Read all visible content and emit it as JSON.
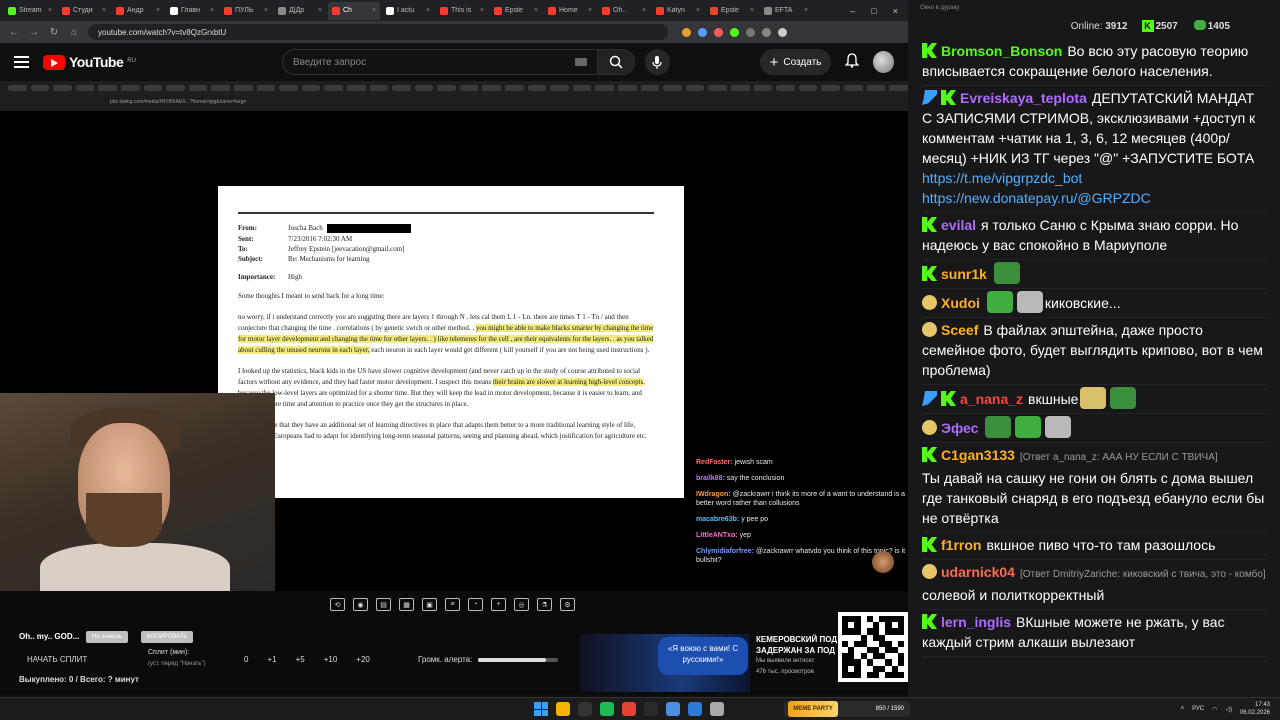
{
  "browser": {
    "tabs": [
      {
        "label": "Stream",
        "color": "#53fc18"
      },
      {
        "label": "Студи",
        "color": "#ff3b30"
      },
      {
        "label": "Андр",
        "color": "#ff3b30"
      },
      {
        "label": "Главн",
        "color": "#ffffff"
      },
      {
        "label": "ПУЛЬ",
        "color": "#ff3b30"
      },
      {
        "label": "Д|Др",
        "color": "#8a8a8a"
      },
      {
        "label": "Ch",
        "color": "#ff3b30",
        "active": true
      },
      {
        "label": "I actu",
        "color": "#ffffff"
      },
      {
        "label": "This is",
        "color": "#ff3b30"
      },
      {
        "label": "Epste",
        "color": "#ff3b30"
      },
      {
        "label": "Home",
        "color": "#ff3b30"
      },
      {
        "label": "Oh..",
        "color": "#ff3b30"
      },
      {
        "label": "Katyn",
        "color": "#ff3b30"
      },
      {
        "label": "Epste",
        "color": "#e04a2a"
      },
      {
        "label": "EFTA",
        "color": "#8a8a8a"
      }
    ],
    "url": "youtube.com/watch?v=tv8QzGrxbtU"
  },
  "youtube": {
    "logo": "YouTube",
    "region": "RU",
    "search_placeholder": "Введите запрос",
    "create_label": "Создать"
  },
  "video": {
    "inner_url": "pbs.twimg.com/media/HFH6hAEX...?format=jpg&name=large",
    "document": {
      "from_label": "From:",
      "from_value": "Joscha Bach",
      "sent_label": "Sent:",
      "sent_value": "7/23/2016 7:02:30 AM",
      "to_label": "To:",
      "to_value": "Jeffrey Epstein [jeevacation@gmail.com]",
      "subject_label": "Subject:",
      "subject_value": "Re: Mechanisms for learning",
      "importance_label": "Importance:",
      "importance_value": "High",
      "intro": "Some thoughts I meant to send back for a long time:",
      "p1_a": "no worry,     if i understand correctly  you are suggsting  there are layers  1 through N .  lets cal them L 1 - Ln.   there are times T 1 - Tn /     and then conjecture  that changing the time . correlations  ( by genetic swtch or other method. , ",
      "p1_hl": "you might be able to make blacks smarter by changing the time for motor layer development  and changing the time for other layers. . )     like telemeres for the cell , are their equivalents for the layers.  . as you talked about culling the unused neurons in each layer,",
      "p1_b": "  each neuron in each layer would get different  ( kill yourself if you are not being used instructions ).",
      "p2_a": "I looked up the statistics, black kids in the US have slower cognitive development (and never catch up in the study of course attributed to social factors without any evidence, and they had faster motor development. I suspect this means ",
      "p2_hl": "their brains are slower at learning high-level concepts",
      "p2_b": ", because the low-level layers are optimized for a shorter time. But they will keep the lead in motor development, because it is easier to learn, and they have more time and attention to practice once they get the structures in place.",
      "p3": "It may also be that they have an additional set of learning directives in place that adapts them better to a more traditional learning style of life, whereas the Europeans had to adapt for identifying long-term seasonal patterns, seeing and planning ahead, which justification for agriculture etc."
    },
    "overlay_chat": [
      {
        "name": "RedFaster:",
        "color": "#ff6b6b",
        "text": "jewish scam"
      },
      {
        "name": "brailk88:",
        "color": "#c07bff",
        "text": "say the conclusion"
      },
      {
        "name": "IWdragon:",
        "color": "#ff9d3b",
        "text": "@zackrawrr i think its more of a want to understand is a better word rather than collusions"
      },
      {
        "name": "macabre63b:",
        "color": "#55c0ff",
        "text": "y pee po"
      },
      {
        "name": "LittleANTxo:",
        "color": "#ff6bd6",
        "text": "yep"
      },
      {
        "name": "Chlymidiaforfree:",
        "color": "#7b9cff",
        "text": "@zackrawrr whatvdo you think of this topic? is it bullshit?"
      }
    ]
  },
  "controls": {
    "video_title": "Oh.. my.. GOD...",
    "pill_1": "Не знаешь",
    "pill_2": "КОПИРОВАТЬ",
    "start_split": "НАЧАТЬ СПЛИТ",
    "split_label": "Сплит (мин):",
    "split_sub": "(уст. перед \"Начать\")",
    "split_values": [
      "0",
      "+1",
      "+5",
      "+10",
      "+20"
    ],
    "alert_volume_label": "Громк. алерта:",
    "alert_volume_fraction": 0.85,
    "bought_summary": "Выкуплено: 0 / Всего: ? минут",
    "promo_bubble": "«Я воюю с вами! С русскими!»",
    "promo_title": "КЕМЕРОВСКИЙ ПОД",
    "promo_sub": "ЗАДЕРЖАН ЗА ПОД",
    "promo_sub2": "Мы выявили антисет",
    "promo_views": "476 тыс. просмотров"
  },
  "chat": {
    "header_hint": "Окно в дураку",
    "online_label": "Online:",
    "online_count": "3912",
    "kick_count": "2507",
    "pepe_count": "1405",
    "messages": [
      {
        "badges": [
          "k"
        ],
        "name": "Bromson_Bonson",
        "color": "#53fc18",
        "text": "Во всю эту расовую теорию вписывается сокращение белого населения."
      },
      {
        "badges": [
          "s",
          "k"
        ],
        "name": "Evreiskaya_teplota",
        "color": "#b06bff",
        "text": "ДЕПУТАТСКИЙ МАНДАТ С ЗАПИСЯМИ СТРИМОВ, эксклюзивами +доступ к комментам +чатик на 1, 3, 6, 12 месяцев (400р/месяц) +НИК ИЗ ТГ через \"@\" +ЗАПУСТИТЕ БОТА ",
        "link1": "https://t.me/vipgrpzdc_bot",
        "link2": "https://new.donatepay.ru/@GRPZDC"
      },
      {
        "badges": [
          "k"
        ],
        "name": "evilal",
        "color": "#b06bff",
        "text": "я только Саню с Крыма знаю сорри. Но надеюсь у вас спокойно в Мариуполе"
      },
      {
        "badges": [
          "k"
        ],
        "name": "sunr1k",
        "color": "#ffb020",
        "text": ""
      },
      {
        "badges": [
          "p"
        ],
        "name": "Xudoi",
        "color": "#ffb020",
        "text": "киковские..."
      },
      {
        "badges": [
          "p"
        ],
        "name": "Sceef",
        "color": "#ffb020",
        "text": "В файлах эпштейна, даже просто семейное фото, будет выглядить криповo, вот в чем проблема)"
      },
      {
        "badges": [
          "s",
          "k"
        ],
        "name": "a_nana_z",
        "color": "#ff4040",
        "text": "вкшные"
      },
      {
        "badges": [
          "p"
        ],
        "name": "Эфес",
        "color": "#b06bff",
        "text": ""
      },
      {
        "badges": [
          "k"
        ],
        "name": "C1gan3133",
        "color": "#ffb020",
        "reply": "[Ответ a_nana_z: ААА НУ ЕСЛИ С ТВИЧА]",
        "text": "Ты давай на сашку не гони он блять с дома вышел где танковый снаряд в его подъезд ебануло если бы не отвёртка"
      },
      {
        "badges": [
          "k"
        ],
        "name": "f1rron",
        "color": "#ffb020",
        "text": "вкшное пиво что-то там разошлось"
      },
      {
        "badges": [
          "p"
        ],
        "name": "udarnick04",
        "color": "#ff6b4a",
        "reply": "[Ответ DmitriyZariche: киковский с твича, это - комбо]",
        "text": "солевой и политкорректный"
      },
      {
        "badges": [
          "k"
        ],
        "name": "lern_inglis",
        "color": "#b06bff",
        "text": "ВКшные можете не ржать, у вас каждый стрим алкаши вылезают"
      }
    ]
  },
  "taskbar": {
    "mini_label": "MEME PARTY",
    "mini_counter": "850 / 1590",
    "lang": "РУС",
    "time": "17:43",
    "date": "06.02.2026"
  }
}
